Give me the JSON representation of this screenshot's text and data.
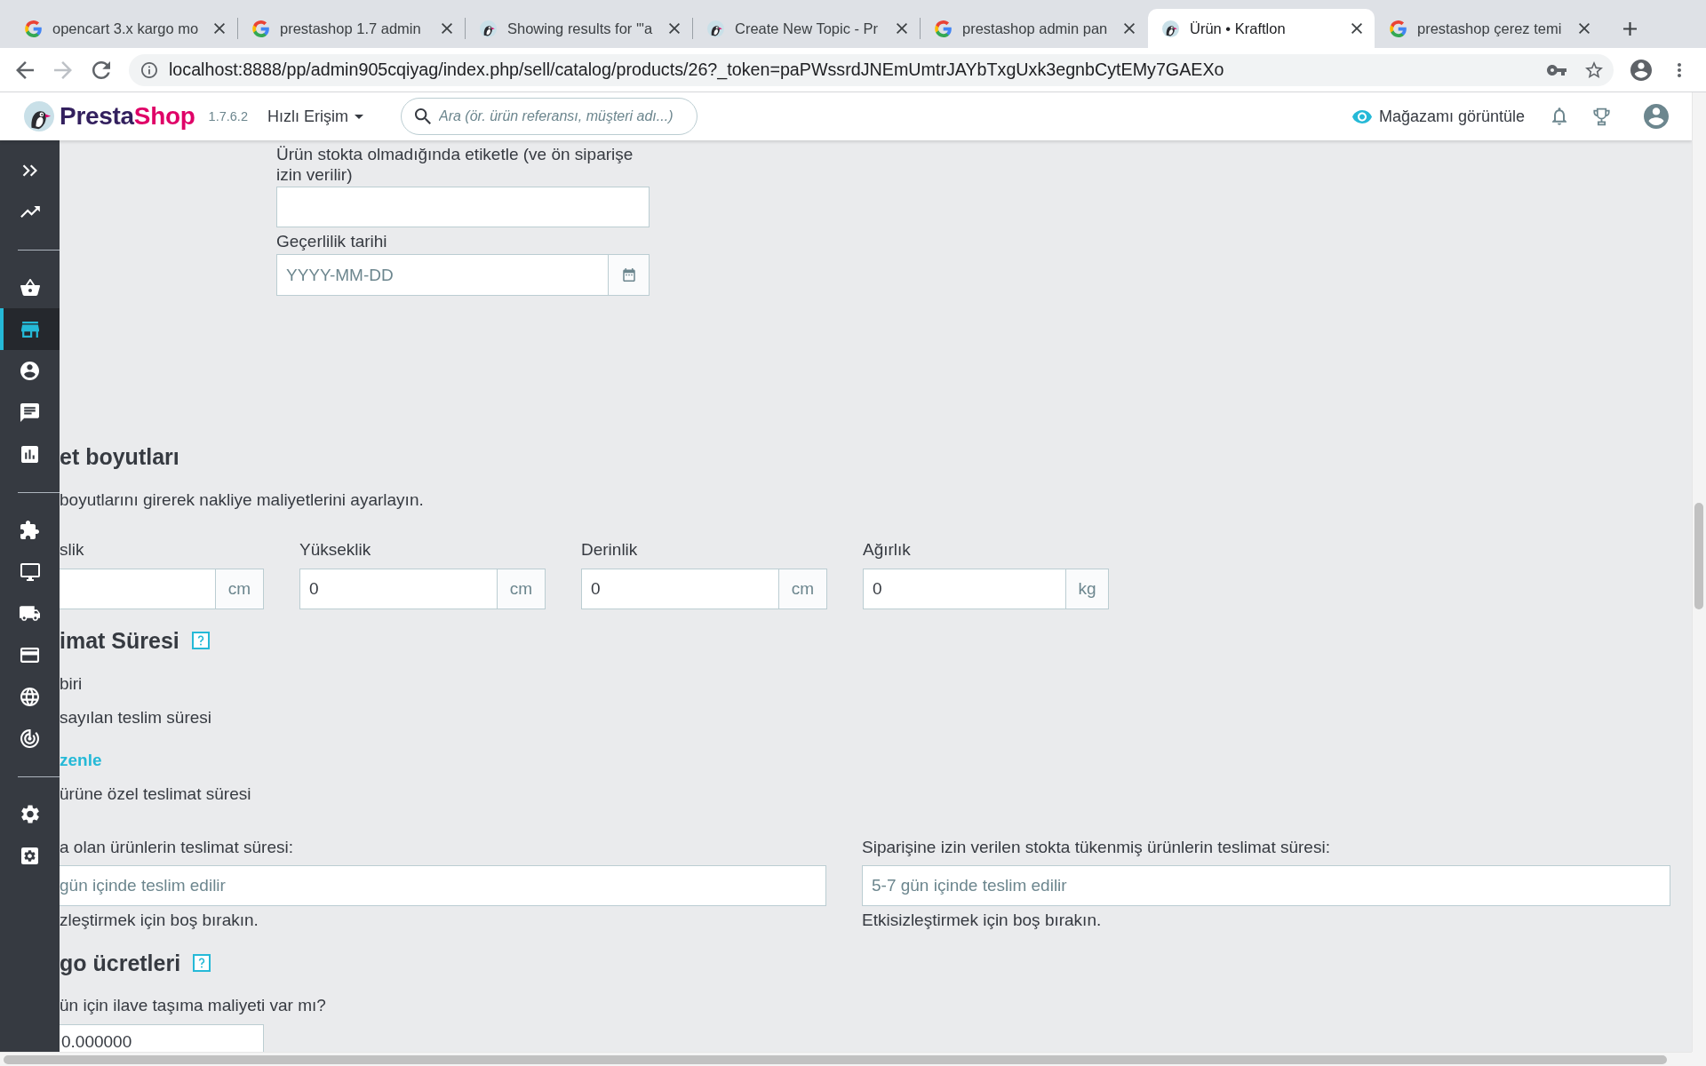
{
  "browser": {
    "tabs": [
      {
        "kind": "search",
        "title": "opencart 3.x kargo mo",
        "selected": false
      },
      {
        "kind": "search",
        "title": "prestashop 1.7 admin",
        "selected": false
      },
      {
        "kind": "site",
        "title": "Showing results for '\"a",
        "selected": false
      },
      {
        "kind": "site",
        "title": "Create New Topic - Pr",
        "selected": false
      },
      {
        "kind": "search",
        "title": "prestashop admin pan",
        "selected": false
      },
      {
        "kind": "site",
        "title": "Ürün • Kraftlon",
        "selected": true
      },
      {
        "kind": "search",
        "title": "prestashop çerez temi",
        "selected": false
      }
    ],
    "nav": [
      {
        "kind": "back",
        "disabled": false
      },
      {
        "kind": "forward",
        "disabled": true
      },
      {
        "kind": "reload",
        "disabled": false
      }
    ],
    "url": "localhost:8888/pp/admin905cqiyag/index.php/sell/catalog/products/26?_token=paPWssrdJNEmUmtrJAYbTxgUxk3egnbCytEMy7GAEXo"
  },
  "header": {
    "logo": "PrestaShop",
    "version": "1.7.6.2",
    "quick_access": "Hızlı Erişim",
    "search": {
      "placeholder": "Ara (ör. ürün referansı, müşteri adı...)"
    },
    "view_store": "Mağazamı görüntüle"
  },
  "sidebar": {
    "groups": [
      {
        "items": [
          {
            "selected": false
          },
          {
            "selected": false
          }
        ]
      },
      {
        "items": [
          {
            "selected": false
          },
          {
            "selected": true
          },
          {
            "selected": false
          },
          {
            "selected": false
          },
          {
            "selected": false
          }
        ]
      },
      {
        "items": [
          {
            "selected": false
          },
          {
            "selected": false
          },
          {
            "selected": false
          },
          {
            "selected": false
          },
          {
            "selected": false
          },
          {
            "selected": false
          }
        ]
      },
      {
        "items": [
          {
            "selected": false
          },
          {
            "selected": false
          }
        ]
      }
    ]
  },
  "form": {
    "out_of_stock_label": {
      "label": "Ürün stokta olmadığında etiketle (ve ön siparişe izin verilir)"
    },
    "availability_date": {
      "label": "Geçerlilik tarihi",
      "placeholder": "YYYY-MM-DD"
    },
    "package_dimensions": {
      "title": "et boyutları",
      "help_icon": false,
      "description": "boyutlarını girerek nakliye maliyetlerini ayarlayın.",
      "fields": [
        {
          "label": "slik",
          "unit": "cm"
        },
        {
          "label": "Yükseklik",
          "value": "0",
          "unit": "cm"
        },
        {
          "label": "Derinlik",
          "value": "0",
          "unit": "cm"
        },
        {
          "label": "Ağırlık",
          "value": "0",
          "unit": "kg"
        }
      ]
    },
    "delivery_time": {
      "title": "imat Süresi",
      "help_icon": true,
      "choices": [
        {
          "kind": "option",
          "text": "biri"
        },
        {
          "kind": "option",
          "text": "sayılan teslim süresi"
        },
        {
          "kind": "link",
          "text": "zenle"
        },
        {
          "kind": "option",
          "text": "ürüne özel teslimat süresi"
        }
      ],
      "fields": [
        {
          "label": "a olan ürünlerin teslimat süresi:",
          "placeholder": "gün içinde teslim edilir",
          "hint": "zleştirmek için boş bırakın."
        },
        {
          "label": "Siparişine izin verilen stokta tükenmiş ürünlerin teslimat süresi:",
          "placeholder": "5-7 gün içinde teslim edilir",
          "hint": "Etkisizleştirmek için boş bırakın."
        }
      ]
    },
    "shipping_fees": {
      "title": "go ücretleri",
      "help_icon": true,
      "question": "ün için ilave taşıma maliyeti var mı?",
      "value": "0.000000"
    }
  }
}
